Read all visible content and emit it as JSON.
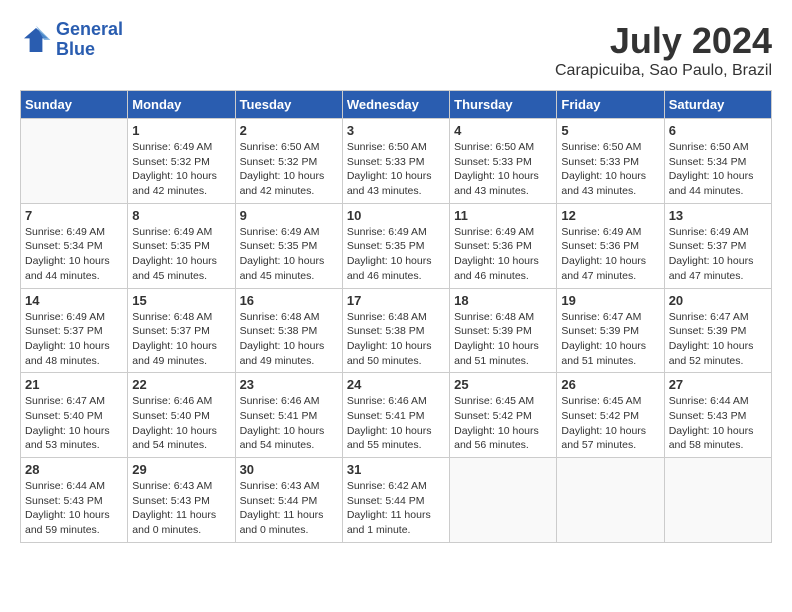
{
  "header": {
    "logo_line1": "General",
    "logo_line2": "Blue",
    "month_year": "July 2024",
    "location": "Carapicuiba, Sao Paulo, Brazil"
  },
  "days_of_week": [
    "Sunday",
    "Monday",
    "Tuesday",
    "Wednesday",
    "Thursday",
    "Friday",
    "Saturday"
  ],
  "weeks": [
    [
      {
        "day": "",
        "empty": true
      },
      {
        "day": "1",
        "sunrise": "6:49 AM",
        "sunset": "5:32 PM",
        "daylight": "10 hours and 42 minutes."
      },
      {
        "day": "2",
        "sunrise": "6:50 AM",
        "sunset": "5:32 PM",
        "daylight": "10 hours and 42 minutes."
      },
      {
        "day": "3",
        "sunrise": "6:50 AM",
        "sunset": "5:33 PM",
        "daylight": "10 hours and 43 minutes."
      },
      {
        "day": "4",
        "sunrise": "6:50 AM",
        "sunset": "5:33 PM",
        "daylight": "10 hours and 43 minutes."
      },
      {
        "day": "5",
        "sunrise": "6:50 AM",
        "sunset": "5:33 PM",
        "daylight": "10 hours and 43 minutes."
      },
      {
        "day": "6",
        "sunrise": "6:50 AM",
        "sunset": "5:34 PM",
        "daylight": "10 hours and 44 minutes."
      }
    ],
    [
      {
        "day": "7",
        "sunrise": "6:49 AM",
        "sunset": "5:34 PM",
        "daylight": "10 hours and 44 minutes."
      },
      {
        "day": "8",
        "sunrise": "6:49 AM",
        "sunset": "5:35 PM",
        "daylight": "10 hours and 45 minutes."
      },
      {
        "day": "9",
        "sunrise": "6:49 AM",
        "sunset": "5:35 PM",
        "daylight": "10 hours and 45 minutes."
      },
      {
        "day": "10",
        "sunrise": "6:49 AM",
        "sunset": "5:35 PM",
        "daylight": "10 hours and 46 minutes."
      },
      {
        "day": "11",
        "sunrise": "6:49 AM",
        "sunset": "5:36 PM",
        "daylight": "10 hours and 46 minutes."
      },
      {
        "day": "12",
        "sunrise": "6:49 AM",
        "sunset": "5:36 PM",
        "daylight": "10 hours and 47 minutes."
      },
      {
        "day": "13",
        "sunrise": "6:49 AM",
        "sunset": "5:37 PM",
        "daylight": "10 hours and 47 minutes."
      }
    ],
    [
      {
        "day": "14",
        "sunrise": "6:49 AM",
        "sunset": "5:37 PM",
        "daylight": "10 hours and 48 minutes."
      },
      {
        "day": "15",
        "sunrise": "6:48 AM",
        "sunset": "5:37 PM",
        "daylight": "10 hours and 49 minutes."
      },
      {
        "day": "16",
        "sunrise": "6:48 AM",
        "sunset": "5:38 PM",
        "daylight": "10 hours and 49 minutes."
      },
      {
        "day": "17",
        "sunrise": "6:48 AM",
        "sunset": "5:38 PM",
        "daylight": "10 hours and 50 minutes."
      },
      {
        "day": "18",
        "sunrise": "6:48 AM",
        "sunset": "5:39 PM",
        "daylight": "10 hours and 51 minutes."
      },
      {
        "day": "19",
        "sunrise": "6:47 AM",
        "sunset": "5:39 PM",
        "daylight": "10 hours and 51 minutes."
      },
      {
        "day": "20",
        "sunrise": "6:47 AM",
        "sunset": "5:39 PM",
        "daylight": "10 hours and 52 minutes."
      }
    ],
    [
      {
        "day": "21",
        "sunrise": "6:47 AM",
        "sunset": "5:40 PM",
        "daylight": "10 hours and 53 minutes."
      },
      {
        "day": "22",
        "sunrise": "6:46 AM",
        "sunset": "5:40 PM",
        "daylight": "10 hours and 54 minutes."
      },
      {
        "day": "23",
        "sunrise": "6:46 AM",
        "sunset": "5:41 PM",
        "daylight": "10 hours and 54 minutes."
      },
      {
        "day": "24",
        "sunrise": "6:46 AM",
        "sunset": "5:41 PM",
        "daylight": "10 hours and 55 minutes."
      },
      {
        "day": "25",
        "sunrise": "6:45 AM",
        "sunset": "5:42 PM",
        "daylight": "10 hours and 56 minutes."
      },
      {
        "day": "26",
        "sunrise": "6:45 AM",
        "sunset": "5:42 PM",
        "daylight": "10 hours and 57 minutes."
      },
      {
        "day": "27",
        "sunrise": "6:44 AM",
        "sunset": "5:43 PM",
        "daylight": "10 hours and 58 minutes."
      }
    ],
    [
      {
        "day": "28",
        "sunrise": "6:44 AM",
        "sunset": "5:43 PM",
        "daylight": "10 hours and 59 minutes."
      },
      {
        "day": "29",
        "sunrise": "6:43 AM",
        "sunset": "5:43 PM",
        "daylight": "11 hours and 0 minutes."
      },
      {
        "day": "30",
        "sunrise": "6:43 AM",
        "sunset": "5:44 PM",
        "daylight": "11 hours and 0 minutes."
      },
      {
        "day": "31",
        "sunrise": "6:42 AM",
        "sunset": "5:44 PM",
        "daylight": "11 hours and 1 minute."
      },
      {
        "day": "",
        "empty": true
      },
      {
        "day": "",
        "empty": true
      },
      {
        "day": "",
        "empty": true
      }
    ]
  ]
}
